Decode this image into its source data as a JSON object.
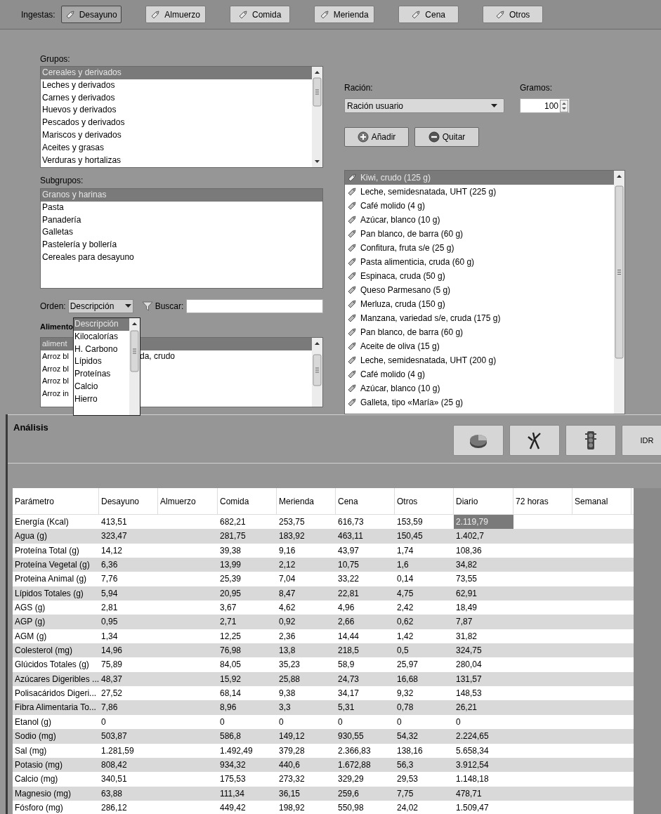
{
  "ingestas": {
    "label": "Ingestas:",
    "buttons": [
      {
        "label": "Desayuno",
        "selected": true
      },
      {
        "label": "Almuerzo",
        "selected": false
      },
      {
        "label": "Comida",
        "selected": false
      },
      {
        "label": "Merienda",
        "selected": false
      },
      {
        "label": "Cena",
        "selected": false
      },
      {
        "label": "Otros",
        "selected": false
      }
    ]
  },
  "grupos": {
    "label": "Grupos:",
    "items": [
      {
        "text": "Cereales y derivados",
        "selected": true
      },
      {
        "text": "Leches y derivados",
        "selected": false
      },
      {
        "text": "Carnes y derivados",
        "selected": false
      },
      {
        "text": "Huevos y derivados",
        "selected": false
      },
      {
        "text": "Pescados y derivados",
        "selected": false
      },
      {
        "text": "Mariscos y derivados",
        "selected": false
      },
      {
        "text": "Aceites y grasas",
        "selected": false
      },
      {
        "text": "Verduras y hortalizas",
        "selected": false
      }
    ]
  },
  "subgrupos": {
    "label": "Subgrupos:",
    "items": [
      {
        "text": "Granos y harinas",
        "selected": true
      },
      {
        "text": "Pasta",
        "selected": false
      },
      {
        "text": "Panadería",
        "selected": false
      },
      {
        "text": "Galletas",
        "selected": false
      },
      {
        "text": "Pastelería y bollería",
        "selected": false
      },
      {
        "text": "Cereales para desayuno",
        "selected": false
      }
    ]
  },
  "orden": {
    "label": "Orden:",
    "value": "Descripción",
    "options": [
      {
        "text": "Descripción",
        "selected": true
      },
      {
        "text": "Kilocalorías",
        "selected": false
      },
      {
        "text": "H. Carbono",
        "selected": false
      },
      {
        "text": "Lípidos",
        "selected": false
      },
      {
        "text": "Proteínas",
        "selected": false
      },
      {
        "text": "Calcio",
        "selected": false
      },
      {
        "text": "Hierro",
        "selected": false
      }
    ]
  },
  "buscar": {
    "label": "Buscar:"
  },
  "alimentos": {
    "label": "Alimento",
    "rows": [
      {
        "text": "aliment",
        "selected": true
      },
      {
        "text": "Arroz bl",
        "tail": "da, crudo",
        "selected": false
      },
      {
        "text": "Arroz bl",
        "selected": false
      },
      {
        "text": "Arroz bl",
        "selected": false
      },
      {
        "text": "Arroz in",
        "selected": false
      }
    ]
  },
  "racion": {
    "label": "Ración:",
    "value": "Ración usuario"
  },
  "gramos": {
    "label": "Gramos:",
    "value": "100"
  },
  "actions": [
    {
      "kind": "add",
      "label": "Añadir"
    },
    {
      "kind": "remove",
      "label": "Quitar"
    }
  ],
  "foods": [
    {
      "text": "Kiwi, crudo (125 g)",
      "selected": true
    },
    {
      "text": "Leche, semidesnatada, UHT (225 g)",
      "selected": false
    },
    {
      "text": "Café molido (4 g)",
      "selected": false
    },
    {
      "text": "Azúcar, blanco (10 g)",
      "selected": false
    },
    {
      "text": "Pan blanco, de barra (60 g)",
      "selected": false
    },
    {
      "text": "Confitura, fruta s/e (25 g)",
      "selected": false
    },
    {
      "text": "Pasta alimenticia, cruda (60 g)",
      "selected": false
    },
    {
      "text": "Espinaca, cruda (50 g)",
      "selected": false
    },
    {
      "text": "Queso Parmesano (5 g)",
      "selected": false
    },
    {
      "text": "Merluza, cruda (150 g)",
      "selected": false
    },
    {
      "text": "Manzana, variedad s/e, cruda (175 g)",
      "selected": false
    },
    {
      "text": "Pan blanco, de barra (60 g)",
      "selected": false
    },
    {
      "text": "Aceite de oliva (15 g)",
      "selected": false
    },
    {
      "text": "Leche, semidesnatada, UHT (200 g)",
      "selected": false
    },
    {
      "text": "Café molido (4 g)",
      "selected": false
    },
    {
      "text": "Azúcar, blanco (10 g)",
      "selected": false
    },
    {
      "text": "Galleta, tipo «María» (25 g)",
      "selected": false
    }
  ],
  "analisis": {
    "title": "Análisis",
    "tools": [
      {
        "kind": "pie"
      },
      {
        "kind": "figure"
      },
      {
        "kind": "traffic"
      },
      {
        "kind": "text",
        "label": "IDR"
      }
    ]
  },
  "table": {
    "columns": [
      "Parámetro",
      "Desayuno",
      "Almuerzo",
      "Comida",
      "Merienda",
      "Cena",
      "Otros",
      "Diario",
      "72 horas",
      "Semanal"
    ],
    "rows": [
      {
        "cells": [
          "Energía (Kcal)",
          "413,51",
          "",
          "682,21",
          "253,75",
          "616,73",
          "153,59",
          "2.119,79"
        ],
        "diario_selected": true
      },
      {
        "cells": [
          "Agua (g)",
          "323,47",
          "",
          "281,75",
          "183,92",
          "463,11",
          "150,45",
          "1.402,7"
        ],
        "diario_selected": false
      },
      {
        "cells": [
          "Proteína Total (g)",
          "14,12",
          "",
          "39,38",
          "9,16",
          "43,97",
          "1,74",
          "108,36"
        ],
        "diario_selected": false
      },
      {
        "cells": [
          "Proteína Vegetal (g)",
          "6,36",
          "",
          "13,99",
          "2,12",
          "10,75",
          "1,6",
          "34,82"
        ],
        "diario_selected": false
      },
      {
        "cells": [
          "Proteina Animal (g)",
          "7,76",
          "",
          "25,39",
          "7,04",
          "33,22",
          "0,14",
          "73,55"
        ],
        "diario_selected": false
      },
      {
        "cells": [
          "Lípidos Totales (g)",
          "5,94",
          "",
          "20,95",
          "8,47",
          "22,81",
          "4,75",
          "62,91"
        ],
        "diario_selected": false
      },
      {
        "cells": [
          "AGS (g)",
          "2,81",
          "",
          "3,67",
          "4,62",
          "4,96",
          "2,42",
          "18,49"
        ],
        "diario_selected": false
      },
      {
        "cells": [
          "AGP (g)",
          "0,95",
          "",
          "2,71",
          "0,92",
          "2,66",
          "0,62",
          "7,87"
        ],
        "diario_selected": false
      },
      {
        "cells": [
          "AGM (g)",
          "1,34",
          "",
          "12,25",
          "2,36",
          "14,44",
          "1,42",
          "31,82"
        ],
        "diario_selected": false
      },
      {
        "cells": [
          "Colesterol (mg)",
          "14,96",
          "",
          "76,98",
          "13,8",
          "218,5",
          "0,5",
          "324,75"
        ],
        "diario_selected": false
      },
      {
        "cells": [
          "Glúcidos Totales (g)",
          "75,89",
          "",
          "84,05",
          "35,23",
          "58,9",
          "25,97",
          "280,04"
        ],
        "diario_selected": false
      },
      {
        "cells": [
          "Azúcares Digeribles ...",
          "48,37",
          "",
          "15,92",
          "25,88",
          "24,73",
          "16,68",
          "131,57"
        ],
        "diario_selected": false
      },
      {
        "cells": [
          "Polisacáridos Digeri...",
          "27,52",
          "",
          "68,14",
          "9,38",
          "34,17",
          "9,32",
          "148,53"
        ],
        "diario_selected": false
      },
      {
        "cells": [
          "Fibra Alimentaria To...",
          "7,86",
          "",
          "8,96",
          "3,3",
          "5,31",
          "0,78",
          "26,21"
        ],
        "diario_selected": false
      },
      {
        "cells": [
          "Etanol (g)",
          "0",
          "",
          "0",
          "0",
          "0",
          "0",
          "0"
        ],
        "diario_selected": false
      },
      {
        "cells": [
          "Sodio (mg)",
          "503,87",
          "",
          "586,8",
          "149,12",
          "930,55",
          "54,32",
          "2.224,65"
        ],
        "diario_selected": false
      },
      {
        "cells": [
          "Sal (mg)",
          "1.281,59",
          "",
          "1.492,49",
          "379,28",
          "2.366,83",
          "138,16",
          "5.658,34"
        ],
        "diario_selected": false
      },
      {
        "cells": [
          "Potasio (mg)",
          "808,42",
          "",
          "934,32",
          "440,6",
          "1.672,88",
          "56,3",
          "3.912,54"
        ],
        "diario_selected": false
      },
      {
        "cells": [
          "Calcio (mg)",
          "340,51",
          "",
          "175,53",
          "273,32",
          "329,29",
          "29,53",
          "1.148,18"
        ],
        "diario_selected": false
      },
      {
        "cells": [
          "Magnesio (mg)",
          "63,88",
          "",
          "111,34",
          "36,15",
          "259,6",
          "7,75",
          "478,71"
        ],
        "diario_selected": false
      },
      {
        "cells": [
          "Fósforo (mg)",
          "286,12",
          "",
          "449,42",
          "198,92",
          "550,98",
          "24,02",
          "1.509,47"
        ],
        "diario_selected": false
      }
    ]
  }
}
